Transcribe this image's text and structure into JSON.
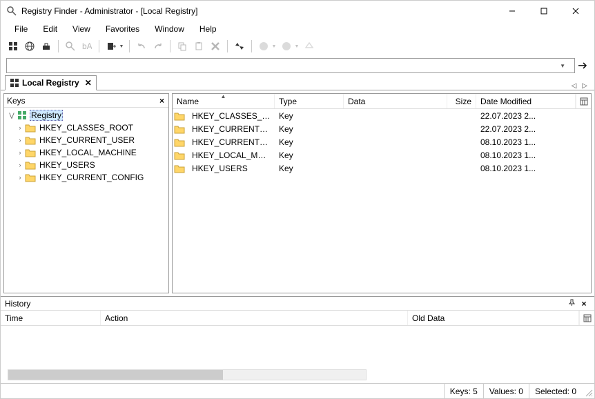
{
  "window": {
    "title": "Registry Finder - Administrator - [Local Registry]"
  },
  "menu": {
    "items": [
      "File",
      "Edit",
      "View",
      "Favorites",
      "Window",
      "Help"
    ]
  },
  "address": {
    "value": ""
  },
  "tab": {
    "label": "Local Registry"
  },
  "tree": {
    "header": "Keys",
    "root": "Registry",
    "items": [
      "HKEY_CLASSES_ROOT",
      "HKEY_CURRENT_USER",
      "HKEY_LOCAL_MACHINE",
      "HKEY_USERS",
      "HKEY_CURRENT_CONFIG"
    ]
  },
  "list": {
    "columns": {
      "name": "Name",
      "type": "Type",
      "data": "Data",
      "size": "Size",
      "date": "Date Modified"
    },
    "rows": [
      {
        "name": "HKEY_CLASSES_ROOT",
        "type": "Key",
        "data": "",
        "size": "",
        "date": "22.07.2023 2..."
      },
      {
        "name": "HKEY_CURRENT_CON...",
        "type": "Key",
        "data": "",
        "size": "",
        "date": "22.07.2023 2..."
      },
      {
        "name": "HKEY_CURRENT_USER",
        "type": "Key",
        "data": "",
        "size": "",
        "date": "08.10.2023 1..."
      },
      {
        "name": "HKEY_LOCAL_MACHI...",
        "type": "Key",
        "data": "",
        "size": "",
        "date": "08.10.2023 1..."
      },
      {
        "name": "HKEY_USERS",
        "type": "Key",
        "data": "",
        "size": "",
        "date": "08.10.2023 1..."
      }
    ]
  },
  "history": {
    "title": "History",
    "columns": {
      "time": "Time",
      "action": "Action",
      "old": "Old Data"
    }
  },
  "status": {
    "keys": "Keys: 5",
    "values": "Values: 0",
    "selected": "Selected: 0"
  }
}
